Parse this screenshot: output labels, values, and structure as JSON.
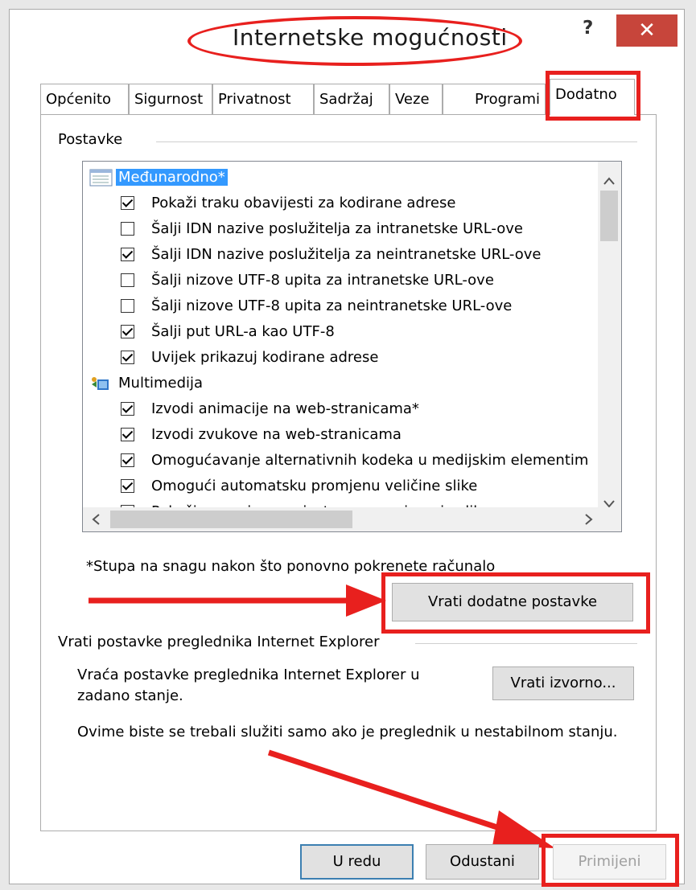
{
  "window": {
    "title": "Internetske mogućnosti",
    "help_label": "?",
    "close_label": "✕"
  },
  "tabs": [
    {
      "label": "Općenito"
    },
    {
      "label": "Sigurnost"
    },
    {
      "label": "Privatnost"
    },
    {
      "label": "Sadržaj"
    },
    {
      "label": "Veze"
    },
    {
      "label": "Programi"
    },
    {
      "label": "Dodatno",
      "active": true
    }
  ],
  "settings": {
    "group_label": "Postavke",
    "tree": [
      {
        "type": "category",
        "icon": "globe-list-icon",
        "label": "Međunarodno*",
        "selected": true
      },
      {
        "type": "option",
        "label": "Pokaži traku obavijesti za kodirane adrese",
        "checked": true
      },
      {
        "type": "option",
        "label": "Šalji IDN nazive poslužitelja za intranetske URL-ove",
        "checked": false
      },
      {
        "type": "option",
        "label": "Šalji IDN nazive poslužitelja za neintranetske URL-ove",
        "checked": true
      },
      {
        "type": "option",
        "label": "Šalji nizove UTF-8 upita za intranetske URL-ove",
        "checked": false
      },
      {
        "type": "option",
        "label": "Šalji nizove UTF-8 upita za neintranetske URL-ove",
        "checked": false
      },
      {
        "type": "option",
        "label": "Šalji put URL-a kao UTF-8",
        "checked": true
      },
      {
        "type": "option",
        "label": "Uvijek prikazuj kodirane adrese",
        "checked": true
      },
      {
        "type": "category",
        "icon": "multimedia-icon",
        "label": "Multimedija",
        "selected": false
      },
      {
        "type": "option",
        "label": "Izvodi animacije na web-stranicama*",
        "checked": true
      },
      {
        "type": "option",
        "label": "Izvodi zvukove na web-stranicama",
        "checked": true
      },
      {
        "type": "option",
        "label": "Omogućavanje alternativnih kodeka u medijskim elementim",
        "checked": true
      },
      {
        "type": "option",
        "label": "Omogući automatsku promjenu veličine slike",
        "checked": true
      },
      {
        "type": "option",
        "label": "Pokaži rezervirana mjesta za preuzimanje slika",
        "checked": true
      }
    ],
    "restart_note": "*Stupa na snagu nakon što ponovno pokrenete računalo",
    "restore_advanced_button": "Vrati dodatne postavke"
  },
  "reset": {
    "group_label": "Vrati postavke preglednika Internet Explorer",
    "description": "Vraća postavke preglednika Internet Explorer u zadano stanje.",
    "reset_button": "Vrati izvorno...",
    "warning": "Ovime biste se trebali služiti samo ako je preglednik u nestabilnom stanju."
  },
  "footer": {
    "ok_button": "U redu",
    "cancel_button": "Odustani",
    "apply_button": "Primijeni"
  },
  "colors": {
    "annotation_red": "#e8201e",
    "selection_blue": "#3399ff",
    "close_red": "#c7453b"
  }
}
